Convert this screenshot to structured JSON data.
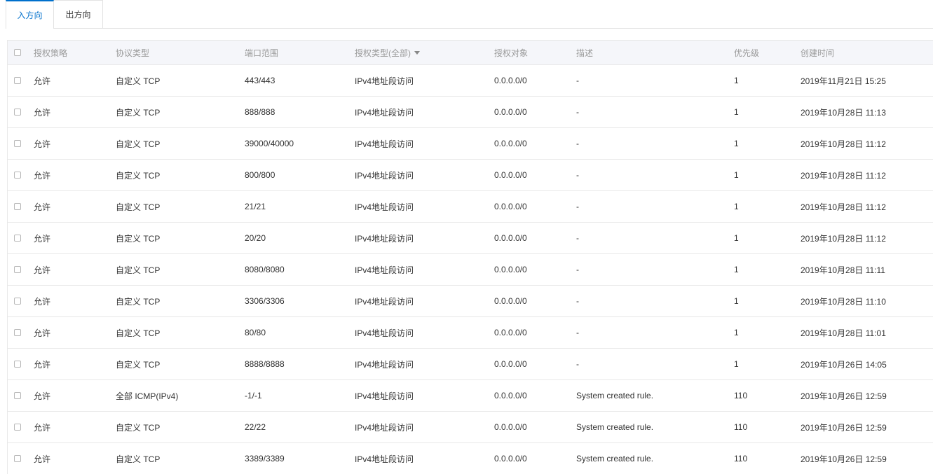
{
  "tabs": {
    "inbound": "入方向",
    "outbound": "出方向"
  },
  "table": {
    "headers": {
      "policy": "授权策略",
      "protocol": "协议类型",
      "port_range": "端口范围",
      "auth_type": "授权类型(全部)",
      "auth_object": "授权对象",
      "description": "描述",
      "priority": "优先级",
      "created": "创建时间"
    },
    "rows": [
      {
        "policy": "允许",
        "protocol": "自定义 TCP",
        "port": "443/443",
        "auth_type": "IPv4地址段访问",
        "object": "0.0.0.0/0",
        "desc": "-",
        "priority": "1",
        "created": "2019年11月21日 15:25"
      },
      {
        "policy": "允许",
        "protocol": "自定义 TCP",
        "port": "888/888",
        "auth_type": "IPv4地址段访问",
        "object": "0.0.0.0/0",
        "desc": "-",
        "priority": "1",
        "created": "2019年10月28日 11:13"
      },
      {
        "policy": "允许",
        "protocol": "自定义 TCP",
        "port": "39000/40000",
        "auth_type": "IPv4地址段访问",
        "object": "0.0.0.0/0",
        "desc": "-",
        "priority": "1",
        "created": "2019年10月28日 11:12"
      },
      {
        "policy": "允许",
        "protocol": "自定义 TCP",
        "port": "800/800",
        "auth_type": "IPv4地址段访问",
        "object": "0.0.0.0/0",
        "desc": "-",
        "priority": "1",
        "created": "2019年10月28日 11:12"
      },
      {
        "policy": "允许",
        "protocol": "自定义 TCP",
        "port": "21/21",
        "auth_type": "IPv4地址段访问",
        "object": "0.0.0.0/0",
        "desc": "-",
        "priority": "1",
        "created": "2019年10月28日 11:12"
      },
      {
        "policy": "允许",
        "protocol": "自定义 TCP",
        "port": "20/20",
        "auth_type": "IPv4地址段访问",
        "object": "0.0.0.0/0",
        "desc": "-",
        "priority": "1",
        "created": "2019年10月28日 11:12"
      },
      {
        "policy": "允许",
        "protocol": "自定义 TCP",
        "port": "8080/8080",
        "auth_type": "IPv4地址段访问",
        "object": "0.0.0.0/0",
        "desc": "-",
        "priority": "1",
        "created": "2019年10月28日 11:11"
      },
      {
        "policy": "允许",
        "protocol": "自定义 TCP",
        "port": "3306/3306",
        "auth_type": "IPv4地址段访问",
        "object": "0.0.0.0/0",
        "desc": "-",
        "priority": "1",
        "created": "2019年10月28日 11:10"
      },
      {
        "policy": "允许",
        "protocol": "自定义 TCP",
        "port": "80/80",
        "auth_type": "IPv4地址段访问",
        "object": "0.0.0.0/0",
        "desc": "-",
        "priority": "1",
        "created": "2019年10月28日 11:01"
      },
      {
        "policy": "允许",
        "protocol": "自定义 TCP",
        "port": "8888/8888",
        "auth_type": "IPv4地址段访问",
        "object": "0.0.0.0/0",
        "desc": "-",
        "priority": "1",
        "created": "2019年10月26日 14:05"
      },
      {
        "policy": "允许",
        "protocol": "全部 ICMP(IPv4)",
        "port": "-1/-1",
        "auth_type": "IPv4地址段访问",
        "object": "0.0.0.0/0",
        "desc": "System created rule.",
        "priority": "110",
        "created": "2019年10月26日 12:59"
      },
      {
        "policy": "允许",
        "protocol": "自定义 TCP",
        "port": "22/22",
        "auth_type": "IPv4地址段访问",
        "object": "0.0.0.0/0",
        "desc": "System created rule.",
        "priority": "110",
        "created": "2019年10月26日 12:59"
      },
      {
        "policy": "允许",
        "protocol": "自定义 TCP",
        "port": "3389/3389",
        "auth_type": "IPv4地址段访问",
        "object": "0.0.0.0/0",
        "desc": "System created rule.",
        "priority": "110",
        "created": "2019年10月26日 12:59"
      }
    ]
  }
}
